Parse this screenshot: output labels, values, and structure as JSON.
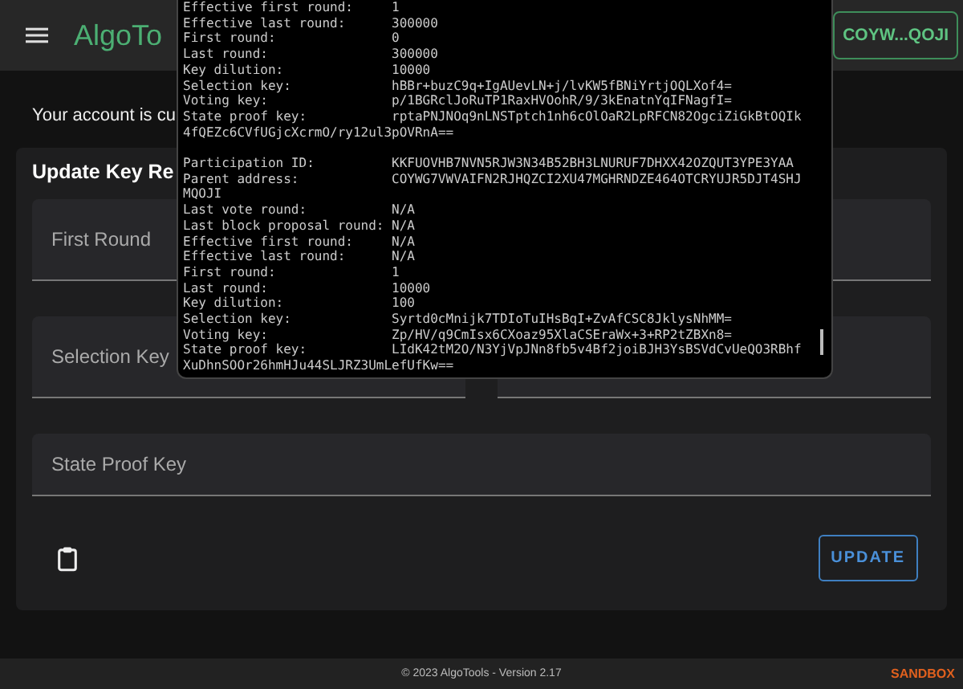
{
  "header": {
    "logo": "AlgoTo",
    "account_button": "COYW...QOJI"
  },
  "notice": "Your account is cu",
  "card": {
    "title": "Update Key Re",
    "fields": [
      {
        "kind": "half",
        "label": "First Round"
      },
      {
        "kind": "half"
      },
      {
        "kind": "half",
        "label": "Selection Key"
      },
      {
        "kind": "half"
      },
      {
        "kind": "full",
        "label": "State Proof Key"
      }
    ],
    "button": "UPDATE"
  },
  "terminal": {
    "lines": [
      {
        "kind": "pair",
        "label": "Effective first round:",
        "value": "1"
      },
      {
        "kind": "pair",
        "label": "Effective last round:",
        "value": "300000"
      },
      {
        "kind": "pair",
        "label": "First round:",
        "value": "0"
      },
      {
        "kind": "pair",
        "label": "Last round:",
        "value": "300000"
      },
      {
        "kind": "pair",
        "label": "Key dilution:",
        "value": "10000"
      },
      {
        "kind": "pair",
        "label": "Selection key:",
        "value": "hBBr+buzC9q+IgAUevLN+j/lvKW5fBNiYrtjOQLXof4="
      },
      {
        "kind": "pair",
        "label": "Voting key:",
        "value": "p/1BGRclJoRuTP1RaxHVOohR/9/3kEnatnYqIFNagfI="
      },
      {
        "kind": "pair",
        "label": "State proof key:",
        "value": "rptaPNJNOq9nLNSTptch1nh6cOlOaR2LpRFCN82OgciZiGkBtOQIk"
      },
      {
        "kind": "wrap",
        "text": "4fQEZc6CVfUGjcXcrmO/ry12ul3pOVRnA=="
      },
      {
        "kind": "blank"
      },
      {
        "kind": "pair",
        "label": "Participation ID:",
        "value": "KKFUOVHB7NVN5RJW3N34B52BH3LNURUF7DHXX42OZQUT3YPE3YAA"
      },
      {
        "kind": "pair",
        "label": "Parent address:",
        "value": "COYWG7VWVAIFN2RJHQZCI2XU47MGHRNDZE464OTCRYUJR5DJT4SHJ"
      },
      {
        "kind": "wrap",
        "text": "MQOJI"
      },
      {
        "kind": "pair",
        "label": "Last vote round:",
        "value": "N/A"
      },
      {
        "kind": "pair",
        "label": "Last block proposal round:",
        "value": "N/A"
      },
      {
        "kind": "pair",
        "label": "Effective first round:",
        "value": "N/A"
      },
      {
        "kind": "pair",
        "label": "Effective last round:",
        "value": "N/A"
      },
      {
        "kind": "pair",
        "label": "First round:",
        "value": "1"
      },
      {
        "kind": "pair",
        "label": "Last round:",
        "value": "10000"
      },
      {
        "kind": "pair",
        "label": "Key dilution:",
        "value": "100"
      },
      {
        "kind": "pair",
        "label": "Selection key:",
        "value": "Syrtd0cMnijk7TDIoTuIHsBqI+ZvAfCSC8JklysNhMM="
      },
      {
        "kind": "pair",
        "label": "Voting key:",
        "value": "Zp/HV/q9CmIsx6CXoaz95XlaCSEraWx+3+RP2tZBXn8="
      },
      {
        "kind": "pair",
        "label": "State proof key:",
        "value": "LIdK42tM2O/N3YjVpJNn8fb5v4Bf2joiBJH3YsBSVdCvUeQO3RBhf"
      },
      {
        "kind": "wrap",
        "text": "XuDhnSOOr26hmHJu44SLJRZ3UmLefUfKw=="
      }
    ]
  },
  "footer": {
    "text": "© 2023 AlgoTools - Version 2.17",
    "badge": "SANDBOX"
  }
}
